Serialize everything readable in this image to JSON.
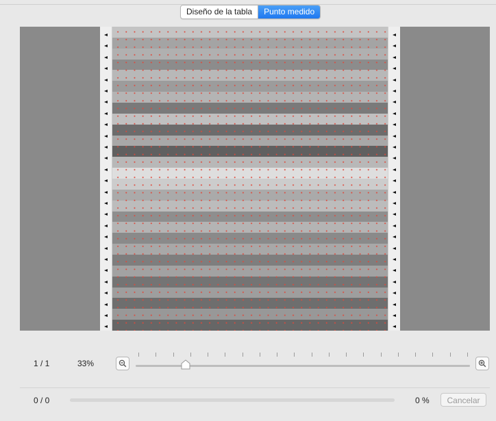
{
  "tabs": {
    "items": [
      {
        "label": "Diseño de la tabla",
        "selected": false
      },
      {
        "label": "Punto medido",
        "selected": true
      }
    ]
  },
  "preview": {
    "patch_row_shades": [
      "#c4c4c4",
      "#a4a4a4",
      "#b0b0b0",
      "#8c8c8c",
      "#b8b8b8",
      "#9c9c9c",
      "#b4b4b4",
      "#7a7a7a",
      "#c0c0c0",
      "#6c6c6c",
      "#a8a8a8",
      "#606060",
      "#b8b8b8",
      "#dedede",
      "#cccccc",
      "#aaaaaa",
      "#bcbcbc",
      "#8e8e8e",
      "#b4b4b4",
      "#8a8a8a",
      "#a8a8a8",
      "#7e7e7e",
      "#a2a2a2",
      "#747474",
      "#9e9e9e",
      "#6e6e6e",
      "#989898",
      "#666666"
    ],
    "dot_color": "#e0483a"
  },
  "zoom": {
    "page_indicator": "1 / 1",
    "value": "33%",
    "level": 0.15,
    "zoom_out_icon": "zoom-out-magnifier",
    "zoom_in_icon": "zoom-in-magnifier"
  },
  "progress": {
    "count": "0 / 0",
    "percent_label": "0 %",
    "fraction": 0,
    "cancel_label": "Cancelar"
  },
  "colors": {
    "accent": "#1f78f0"
  }
}
